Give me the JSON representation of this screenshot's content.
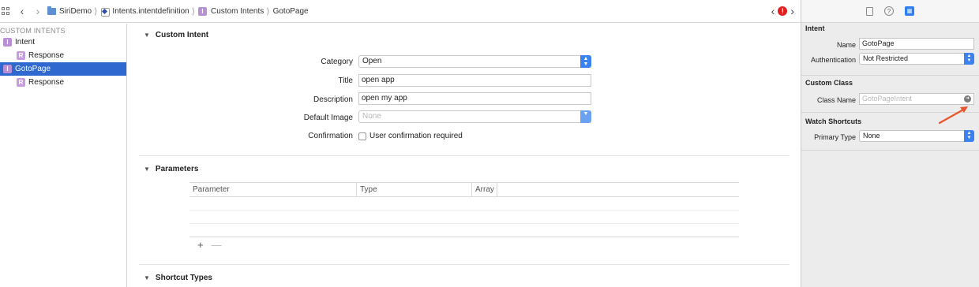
{
  "jumpbar": {
    "crumbs": [
      "SiriDemo",
      "Intents.intentdefinition",
      "Custom Intents",
      "GotoPage"
    ],
    "back_icon": "chevron-left-icon",
    "forward_icon": "chevron-right-icon",
    "error_count": "!"
  },
  "outline": {
    "header": "CUSTOM INTENTS",
    "items": [
      {
        "badge": "I",
        "label": "Intent"
      },
      {
        "badge": "R",
        "label": "Response"
      },
      {
        "badge": "I",
        "label": "GotoPage"
      },
      {
        "badge": "R",
        "label": "Response"
      }
    ]
  },
  "editor": {
    "custom_intent": {
      "title": "Custom Intent",
      "category_label": "Category",
      "category_value": "Open",
      "title_label": "Title",
      "title_value": "open app",
      "description_label": "Description",
      "description_value": "open my app",
      "default_image_label": "Default Image",
      "default_image_value": "None",
      "confirmation_label": "Confirmation",
      "confirmation_checkbox": "User confirmation required"
    },
    "parameters": {
      "title": "Parameters",
      "columns": [
        "Parameter",
        "Type",
        "Array"
      ],
      "add": "+",
      "remove": "—"
    },
    "shortcut_types": {
      "title": "Shortcut Types"
    }
  },
  "inspector": {
    "intent_section": "Intent",
    "name_label": "Name",
    "name_value": "GotoPage",
    "authentication_label": "Authentication",
    "authentication_value": "Not Restricted",
    "custom_class_section": "Custom Class",
    "class_name_label": "Class Name",
    "class_name_placeholder": "GotoPageIntent",
    "watch_section": "Watch Shortcuts",
    "primary_type_label": "Primary Type",
    "primary_type_value": "None"
  },
  "colors": {
    "selection": "#2f68cf",
    "intent_badge": "#b98fd6",
    "popup_stepper": "#3b82f0",
    "error": "#e02020",
    "annotation_arrow": "#e8552a"
  }
}
